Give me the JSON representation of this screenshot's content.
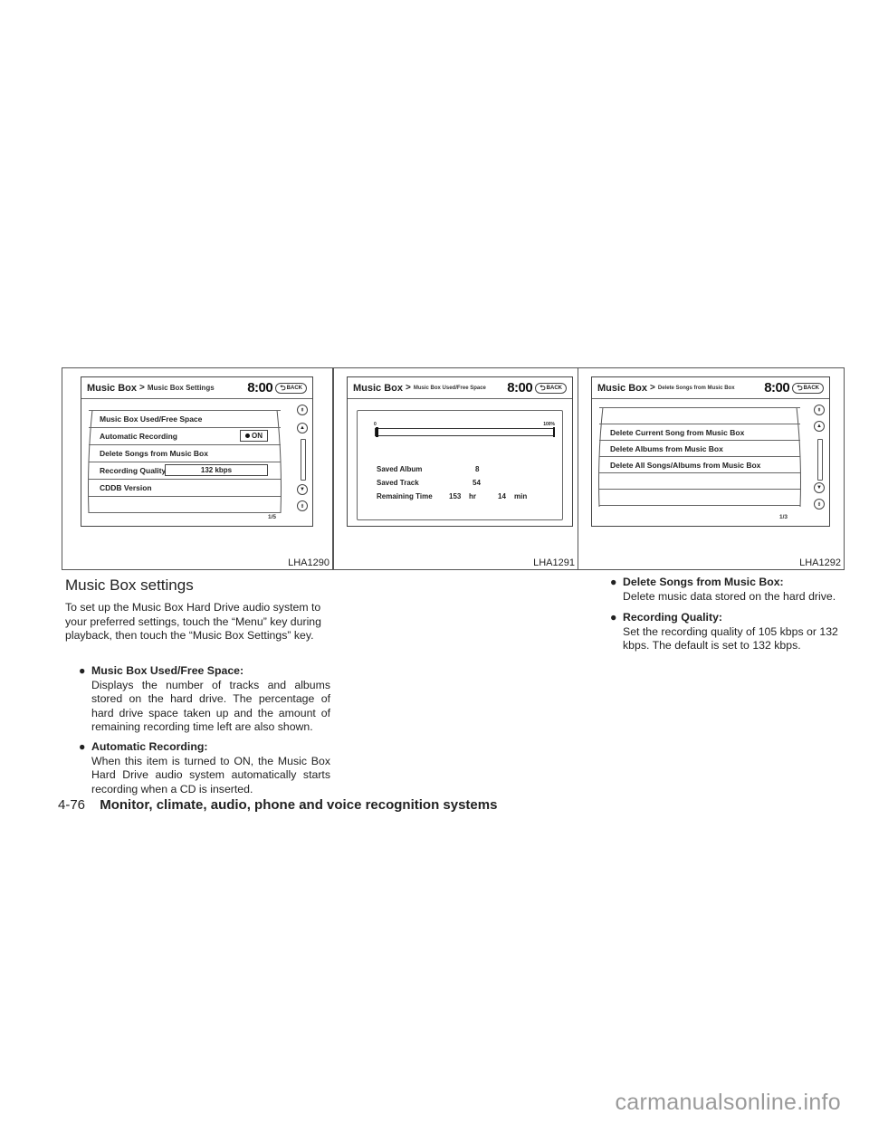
{
  "figures": [
    {
      "code": "LHA1290",
      "header": {
        "main": "Music Box",
        "separator": ">",
        "sub": "Music Box Settings",
        "clock": "8:00",
        "back_label": "BACK"
      },
      "rows": [
        {
          "label": "Music Box Used/Free Space"
        },
        {
          "label": "Automatic Recording",
          "toggle": "ON"
        },
        {
          "label": "Delete Songs from Music Box"
        },
        {
          "label": "Recording Quality",
          "value": "132 kbps"
        },
        {
          "label": "CDDB Version"
        },
        {
          "label": ""
        }
      ],
      "pager": "1/5"
    },
    {
      "code": "LHA1291",
      "header": {
        "main": "Music Box",
        "separator": ">",
        "sub": "Music Box Used/Free Space",
        "clock": "8:00",
        "back_label": "BACK"
      },
      "usage_bar": {
        "min_label": "0",
        "max_label": "100%",
        "used_fraction": 0.01
      },
      "stats": [
        {
          "label": "Saved Album",
          "value": "8"
        },
        {
          "label": "Saved Track",
          "value": "54"
        },
        {
          "label": "Remaining Time",
          "hours": "153",
          "hours_unit": "hr",
          "minutes": "14",
          "minutes_unit": "min"
        }
      ]
    },
    {
      "code": "LHA1292",
      "header": {
        "main": "Music Box",
        "separator": ">",
        "sub": "Delete Songs from Music Box",
        "clock": "8:00",
        "back_label": "BACK"
      },
      "rows": [
        {
          "label": ""
        },
        {
          "label": "Delete Current Song from Music Box"
        },
        {
          "label": "Delete Albums from Music Box"
        },
        {
          "label": "Delete All Songs/Albums from Music Box"
        },
        {
          "label": ""
        },
        {
          "label": ""
        }
      ],
      "pager": "1/3"
    }
  ],
  "section": {
    "heading": "Music Box settings",
    "intro": "To set up the Music Box Hard Drive audio system to your preferred settings, touch the “Menu” key during playback, then touch the “Music Box Settings” key.",
    "bullets": [
      {
        "title": "Music Box Used/Free Space:",
        "text": "Displays the number of tracks and albums stored on the hard drive. The percentage of hard drive space taken up and the amount of remaining recording time left are also shown."
      },
      {
        "title": "Automatic Recording:",
        "text": "When this item is turned to ON, the Music Box Hard Drive audio system automatically starts recording when a CD is inserted."
      },
      {
        "title": "Delete Songs from Music Box:",
        "text": "Delete music data stored on the hard drive."
      },
      {
        "title": "Recording Quality:",
        "text": "Set the recording quality of 105 kbps or 132 kbps. The default is set to 132 kbps."
      }
    ]
  },
  "footer": {
    "page": "4-76",
    "section_title": "Monitor, climate, audio, phone and voice recognition systems"
  },
  "watermark": "carmanualsonline.info",
  "icons": {
    "bullet": "●",
    "back": "⮌",
    "scroll_top": "⇞",
    "scroll_up": "▲",
    "scroll_down": "▼",
    "scroll_bottom": "⇟"
  }
}
